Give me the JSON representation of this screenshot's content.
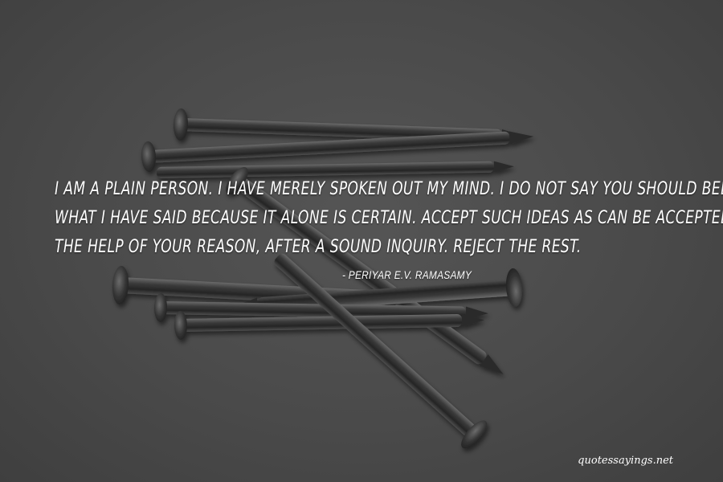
{
  "quote": {
    "lines": [
      "I am a plain person. I have merely spoken out my mind. I do not say you should believe",
      "what I have said because it alone is certain. Accept such ideas as can be accepted, with",
      "the help of your reason, after a sound inquiry. Reject the rest."
    ]
  },
  "author": "- Periyar E.V. Ramasamy",
  "watermark": "quotessayings.net",
  "colors": {
    "background": "#4a4a4a",
    "text": "#ffffff",
    "nail": "#2e2e2e"
  }
}
